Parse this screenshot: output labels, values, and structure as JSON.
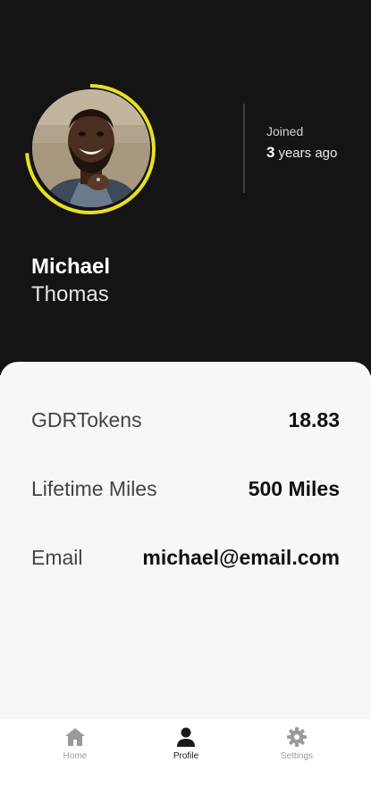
{
  "profile": {
    "first_name": "Michael",
    "last_name": "Thomas",
    "joined_label": "Joined",
    "joined_number": "3",
    "joined_suffix": "years ago"
  },
  "stats": [
    {
      "label": "GDRTokens",
      "value": "18.83"
    },
    {
      "label": "Lifetime Miles",
      "value": "500 Miles"
    },
    {
      "label": "Email",
      "value": "michael@email.com"
    }
  ],
  "nav": {
    "home": "Home",
    "profile": "Profile",
    "settings": "Settings",
    "active": "profile"
  },
  "colors": {
    "header_bg": "#141414",
    "ring_accent": "#e8e021",
    "card_bg": "#f7f7f7",
    "nav_inactive": "#9a9a9a",
    "nav_active": "#1a1a1a"
  },
  "icons": {
    "home": "home-icon",
    "profile": "person-icon",
    "settings": "gear-icon"
  }
}
